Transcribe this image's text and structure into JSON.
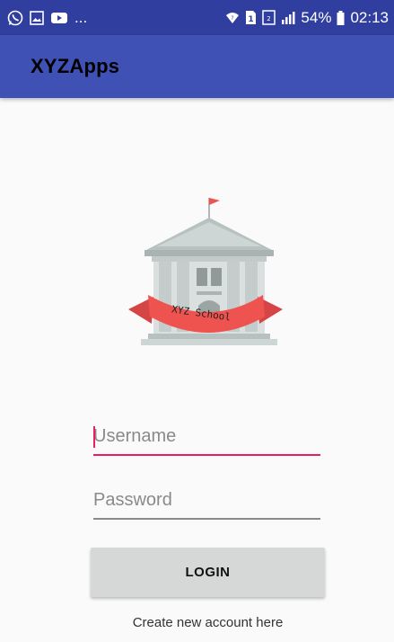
{
  "status_bar": {
    "left_icons": [
      "whatsapp-icon",
      "image-icon",
      "youtube-icon"
    ],
    "overflow": "...",
    "right_icons": [
      "wifi-icon",
      "sim-1-icon",
      "sim-lte-icon",
      "signal-icon"
    ],
    "battery": "54%",
    "time": "02:13"
  },
  "app_bar": {
    "title": "XYZApps",
    "color": "#3f51b5",
    "status_color": "#303f9f"
  },
  "logo": {
    "banner_text": "XYZ School",
    "icon": "school-building-icon"
  },
  "form": {
    "username_placeholder": "Username",
    "password_placeholder": "Password",
    "login_label": "LOGIN",
    "create_account_text": "Create new account here",
    "accent_color": "#e91e63"
  }
}
